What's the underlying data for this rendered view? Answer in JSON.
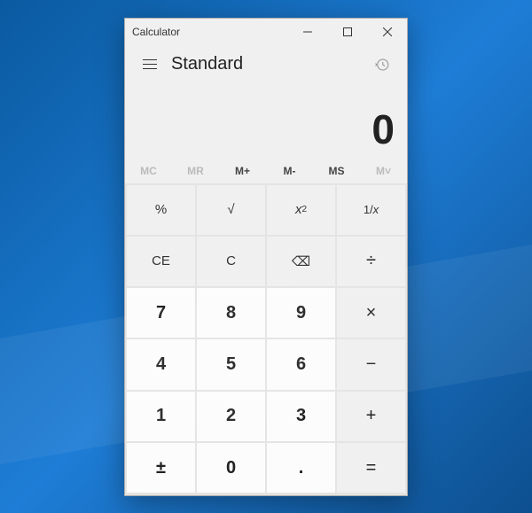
{
  "window": {
    "title": "Calculator"
  },
  "header": {
    "mode": "Standard"
  },
  "display": {
    "value": "0"
  },
  "memory": {
    "mc": "MC",
    "mr": "MR",
    "mplus": "M+",
    "mminus": "M-",
    "ms": "MS",
    "mlist": "M˅"
  },
  "keys": {
    "percent": "%",
    "sqrt": "√",
    "square_base": "x",
    "square_exp": "2",
    "recip_num": "1",
    "recip_den": "x",
    "ce": "CE",
    "c": "C",
    "back": "⌫",
    "div": "÷",
    "n7": "7",
    "n8": "8",
    "n9": "9",
    "mul": "×",
    "n4": "4",
    "n5": "5",
    "n6": "6",
    "sub": "−",
    "n1": "1",
    "n2": "2",
    "n3": "3",
    "add": "+",
    "neg": "±",
    "n0": "0",
    "dot": ".",
    "eq": "="
  }
}
